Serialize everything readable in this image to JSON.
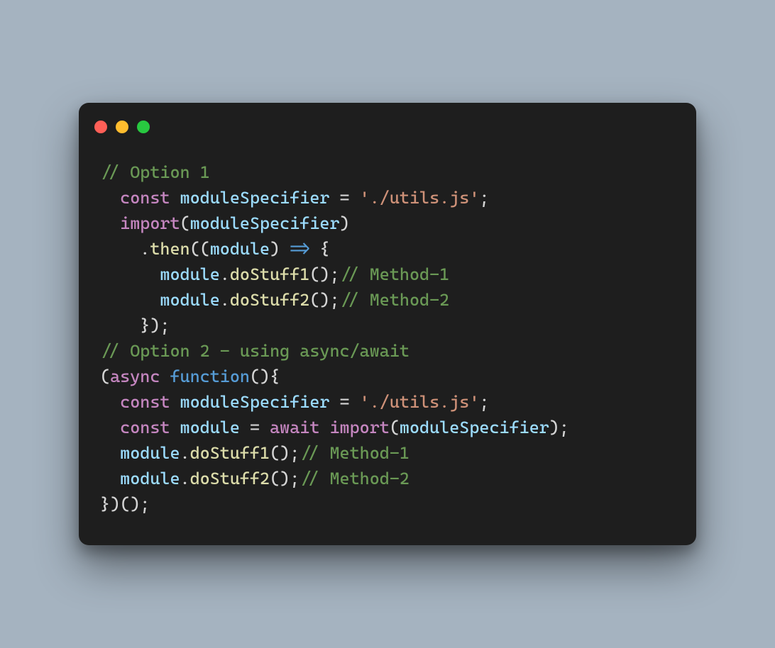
{
  "titlebar": {
    "dots": [
      "close",
      "minimize",
      "zoom"
    ]
  },
  "code": {
    "lines": [
      {
        "indent": 0,
        "spans": [
          {
            "cls": "c-comment",
            "t": "// Option 1"
          }
        ]
      },
      {
        "indent": 1,
        "spans": [
          {
            "cls": "c-keyword",
            "t": "const"
          },
          {
            "cls": "c-punct",
            "t": " "
          },
          {
            "cls": "c-var",
            "t": "moduleSpecifier"
          },
          {
            "cls": "c-punct",
            "t": " = "
          },
          {
            "cls": "c-string",
            "t": "'./utils.js'"
          },
          {
            "cls": "c-punct",
            "t": ";"
          }
        ]
      },
      {
        "indent": 1,
        "spans": [
          {
            "cls": "c-keyword",
            "t": "import"
          },
          {
            "cls": "c-punct",
            "t": "("
          },
          {
            "cls": "c-var",
            "t": "moduleSpecifier"
          },
          {
            "cls": "c-punct",
            "t": ")"
          }
        ]
      },
      {
        "indent": 2,
        "spans": [
          {
            "cls": "c-punct",
            "t": "."
          },
          {
            "cls": "c-func",
            "t": "then"
          },
          {
            "cls": "c-punct",
            "t": "(("
          },
          {
            "cls": "c-var",
            "t": "module"
          },
          {
            "cls": "c-punct",
            "t": ") "
          },
          {
            "cls": "c-storage",
            "t": "=>"
          },
          {
            "cls": "c-punct",
            "t": " {"
          }
        ]
      },
      {
        "indent": 3,
        "spans": [
          {
            "cls": "c-var",
            "t": "module"
          },
          {
            "cls": "c-punct",
            "t": "."
          },
          {
            "cls": "c-func",
            "t": "doStuff1"
          },
          {
            "cls": "c-punct",
            "t": "();"
          },
          {
            "cls": "c-comment",
            "t": "// Method-1"
          }
        ]
      },
      {
        "indent": 3,
        "spans": [
          {
            "cls": "c-var",
            "t": "module"
          },
          {
            "cls": "c-punct",
            "t": "."
          },
          {
            "cls": "c-func",
            "t": "doStuff2"
          },
          {
            "cls": "c-punct",
            "t": "();"
          },
          {
            "cls": "c-comment",
            "t": "// Method-2"
          }
        ]
      },
      {
        "indent": 2,
        "spans": [
          {
            "cls": "c-punct",
            "t": "});"
          }
        ]
      },
      {
        "indent": 0,
        "spans": [
          {
            "cls": "c-punct",
            "t": ""
          }
        ]
      },
      {
        "indent": 0,
        "spans": [
          {
            "cls": "c-comment",
            "t": "// Option 2 - using async/await"
          }
        ]
      },
      {
        "indent": 0,
        "spans": [
          {
            "cls": "c-punct",
            "t": "("
          },
          {
            "cls": "c-keyword",
            "t": "async"
          },
          {
            "cls": "c-punct",
            "t": " "
          },
          {
            "cls": "c-storage",
            "t": "function"
          },
          {
            "cls": "c-punct",
            "t": "(){"
          }
        ]
      },
      {
        "indent": 1,
        "spans": [
          {
            "cls": "c-keyword",
            "t": "const"
          },
          {
            "cls": "c-punct",
            "t": " "
          },
          {
            "cls": "c-var",
            "t": "moduleSpecifier"
          },
          {
            "cls": "c-punct",
            "t": " = "
          },
          {
            "cls": "c-string",
            "t": "'./utils.js'"
          },
          {
            "cls": "c-punct",
            "t": ";"
          }
        ]
      },
      {
        "indent": 1,
        "spans": [
          {
            "cls": "c-keyword",
            "t": "const"
          },
          {
            "cls": "c-punct",
            "t": " "
          },
          {
            "cls": "c-var",
            "t": "module"
          },
          {
            "cls": "c-punct",
            "t": " = "
          },
          {
            "cls": "c-keyword",
            "t": "await"
          },
          {
            "cls": "c-punct",
            "t": " "
          },
          {
            "cls": "c-keyword",
            "t": "import"
          },
          {
            "cls": "c-punct",
            "t": "("
          },
          {
            "cls": "c-var",
            "t": "moduleSpecifier"
          },
          {
            "cls": "c-punct",
            "t": ");"
          }
        ]
      },
      {
        "indent": 1,
        "spans": [
          {
            "cls": "c-var",
            "t": "module"
          },
          {
            "cls": "c-punct",
            "t": "."
          },
          {
            "cls": "c-func",
            "t": "doStuff1"
          },
          {
            "cls": "c-punct",
            "t": "();"
          },
          {
            "cls": "c-comment",
            "t": "// Method-1"
          }
        ]
      },
      {
        "indent": 1,
        "spans": [
          {
            "cls": "c-var",
            "t": "module"
          },
          {
            "cls": "c-punct",
            "t": "."
          },
          {
            "cls": "c-func",
            "t": "doStuff2"
          },
          {
            "cls": "c-punct",
            "t": "();"
          },
          {
            "cls": "c-comment",
            "t": "// Method-2"
          }
        ]
      },
      {
        "indent": 0,
        "spans": [
          {
            "cls": "c-punct",
            "t": "})();"
          }
        ]
      }
    ]
  }
}
